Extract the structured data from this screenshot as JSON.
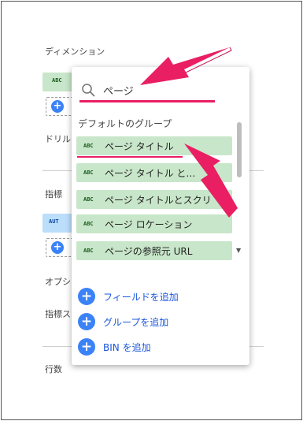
{
  "panel": {
    "dimension_label": "ディメンション",
    "drill_label": "ドリル",
    "metric_label": "指標",
    "option_label": "オプシ",
    "metric2_label": "指標ス",
    "rows_label": "行数",
    "dim_chip_tag": "ABC",
    "metric_chip_tag": "AUT"
  },
  "search": {
    "value": "ページ"
  },
  "group_title": "デフォルトのグループ",
  "items": [
    {
      "tag": "ABC",
      "label": "ページ タイトル"
    },
    {
      "tag": "ABC",
      "label": "ページ タイトル と…"
    },
    {
      "tag": "ABC",
      "label": "ページ タイトルとスクリ"
    },
    {
      "tag": "ABC",
      "label": "ページ ロケーション"
    },
    {
      "tag": "ABC",
      "label": "ページの参照元 URL"
    }
  ],
  "actions": [
    {
      "label": "フィールドを追加"
    },
    {
      "label": "グループを追加"
    },
    {
      "label": "BIN を追加"
    }
  ],
  "colors": {
    "accent_pink": "#e91e63",
    "dimension_green": "#c8e6c9",
    "metric_blue": "#bbdefb",
    "action_blue": "#3b82f6"
  }
}
